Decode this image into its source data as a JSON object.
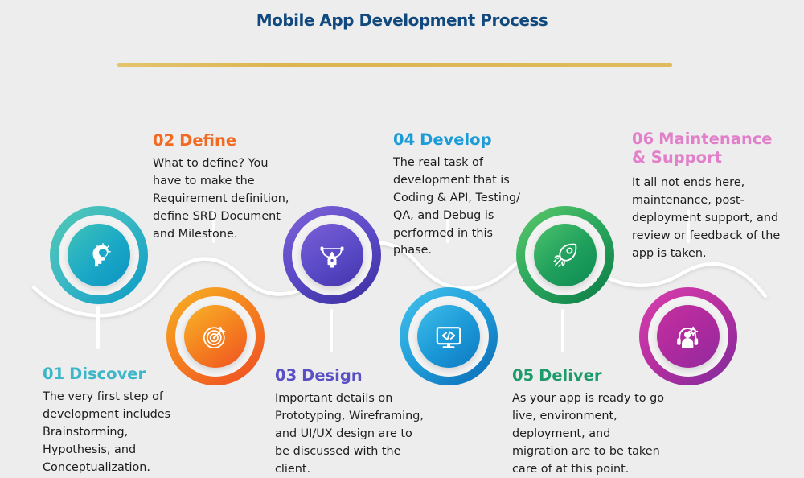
{
  "page": {
    "title": "Mobile App Development Process",
    "background_color": "#ededed",
    "title_color": "#11497e",
    "rule_color": "#dfbb5d",
    "body_text_color": "#1d1d1d"
  },
  "steps": [
    {
      "number": "01",
      "label": "Discover",
      "color": "#3cb6c9",
      "icon": "head-lightbulb-icon",
      "icon_alt": "brainstorming",
      "gradient_from": "#52c8b4",
      "gradient_to": "#0b9ac4",
      "body": "The very first step of development includes Brainstorming, Hypothesis, and Conceptualization.",
      "position": "below"
    },
    {
      "number": "02",
      "label": "Define",
      "color": "#f26a21",
      "icon": "target-arrow-icon",
      "icon_alt": "target with arrow",
      "gradient_from": "#f5a623",
      "gradient_to": "#ef4e23",
      "body": "What to define? You have to make the Requirement definition, define SRD Document and Milestone.",
      "position": "above"
    },
    {
      "number": "03",
      "label": "Design",
      "color": "#5a4fc4",
      "icon": "pen-tool-icon",
      "icon_alt": "bezier pen tool",
      "gradient_from": "#7b5fd4",
      "gradient_to": "#3b33a8",
      "body": "Important details on Prototyping, Wireframing, and UI/UX design are to be discussed with the client.",
      "position": "below"
    },
    {
      "number": "04",
      "label": "Develop",
      "color": "#1b9bd8",
      "icon": "monitor-code-icon",
      "icon_alt": "monitor with code brackets",
      "gradient_from": "#3bb9e8",
      "gradient_to": "#0d72b8",
      "body": "The real task of development that is Coding & API, Testing/ QA, and Debug is performed in this phase.",
      "position": "above"
    },
    {
      "number": "05",
      "label": "Deliver",
      "color": "#1e9b6b",
      "icon": "rocket-icon",
      "icon_alt": "rocket launch",
      "gradient_from": "#4fc16a",
      "gradient_to": "#0d7a4a",
      "body": "As your app is ready to go live, environment, deployment, and migration are to be taken care of at this point.",
      "position": "below"
    },
    {
      "number": "06",
      "label": "Maintenance\n& Support",
      "color": "#e27fc9",
      "icon": "headset-gear-icon",
      "icon_alt": "support headset with gear",
      "gradient_from": "#d63fa8",
      "gradient_to": "#8e2b9e",
      "body": "It all not ends here, maintenance, post-deployment support, and review or feedback of the app is taken.",
      "position": "above"
    }
  ]
}
